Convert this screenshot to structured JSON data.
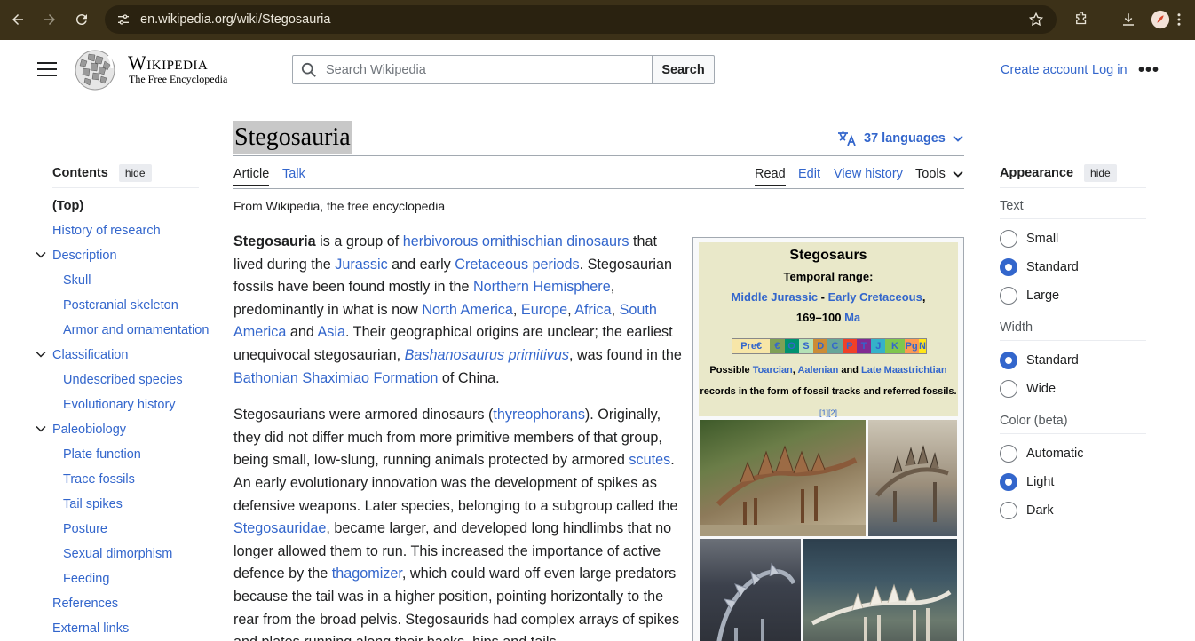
{
  "browser": {
    "url": "en.wikipedia.org/wiki/Stegosauria"
  },
  "header": {
    "wordmark": "Wikipedia",
    "tagline": "The Free Encyclopedia",
    "search_placeholder": "Search Wikipedia",
    "search_button": "Search",
    "create_account": "Create account",
    "log_in": "Log in"
  },
  "toc": {
    "title": "Contents",
    "hide": "hide",
    "items": [
      {
        "label": "(Top)"
      },
      {
        "label": "History of research"
      },
      {
        "label": "Description"
      },
      {
        "label": "Skull"
      },
      {
        "label": "Postcranial skeleton"
      },
      {
        "label": "Armor and ornamentation"
      },
      {
        "label": "Classification"
      },
      {
        "label": "Undescribed species"
      },
      {
        "label": "Evolutionary history"
      },
      {
        "label": "Paleobiology"
      },
      {
        "label": "Plate function"
      },
      {
        "label": "Trace fossils"
      },
      {
        "label": "Tail spikes"
      },
      {
        "label": "Posture"
      },
      {
        "label": "Sexual dimorphism"
      },
      {
        "label": "Feeding"
      },
      {
        "label": "References"
      },
      {
        "label": "External links"
      }
    ]
  },
  "page": {
    "title": "Stegosauria",
    "languages": "37 languages",
    "tabs": {
      "article": "Article",
      "talk": "Talk",
      "read": "Read",
      "edit": "Edit",
      "history": "View history",
      "tools": "Tools"
    },
    "from": "From Wikipedia, the free encyclopedia"
  },
  "body": {
    "p1": {
      "a": "Stegosauria",
      "b": " is a group of ",
      "c": "herbivorous",
      "d": " ",
      "e": "ornithischian",
      "f": " ",
      "g": "dinosaurs",
      "h": " that lived during the ",
      "i": "Jurassic",
      "j": " and early ",
      "k": "Cretaceous periods",
      "l": ". Stegosaurian fossils have been found mostly in the ",
      "m": "Northern Hemisphere",
      "n": ", predominantly in what is now ",
      "o": "North America",
      "p": ", ",
      "q": "Europe",
      "r": ", ",
      "s": "Africa",
      "t": ", ",
      "u": "South America",
      "v": " and ",
      "w": "Asia",
      "x": ". Their geographical origins are unclear; the earliest unequivocal stegosaurian, ",
      "y": "Bashanosaurus primitivus",
      "z": ", was found in the ",
      "aa": "Bathonian",
      "ab": " ",
      "ac": "Shaximiao Formation",
      "ad": " of China."
    },
    "p2": {
      "a": "Stegosaurians were armored dinosaurs (",
      "b": "thyreophorans",
      "c": "). Originally, they did not differ much from more primitive members of that group, being small, low-slung, running animals protected by armored ",
      "d": "scutes",
      "e": ". An early evolutionary innovation was the development of spikes as defensive weapons. Later species, belonging to a subgroup called the ",
      "f": "Stegosauridae",
      "g": ", became larger, and developed long hindlimbs that no longer allowed them to run. This increased the importance of active defence by the ",
      "h": "thagomizer",
      "i": ", which could ward off even large predators because the tail was in a higher position, pointing horizontally to the rear from the broad pelvis. Stegosaurids had complex arrays of spikes and plates running along their backs, hips and tails."
    }
  },
  "infobox": {
    "title": "Stegosaurs",
    "range_label": "Temporal range:",
    "range_start": "Middle Jurassic",
    "range_sep": " - ",
    "range_end": "Early Cretaceous",
    "range_comma": ",",
    "ma_value": "169–100 ",
    "ma_unit": "Ma",
    "timeline": [
      "Pre€",
      "€",
      "O",
      "S",
      "D",
      "C",
      "P",
      "T",
      "J",
      "K",
      "Pg",
      "N"
    ],
    "note_a": "Possible ",
    "note_b": "Toarcian",
    "note_c": ", ",
    "note_d": "Aalenian",
    "note_e": " and ",
    "note_f": "Late Maastrichtian",
    "note_g": " records in the form of fossil tracks and referred fossils.",
    "note_refs": "[1][2]"
  },
  "appearance": {
    "title": "Appearance",
    "hide": "hide",
    "text_label": "Text",
    "text_options": [
      "Small",
      "Standard",
      "Large"
    ],
    "width_label": "Width",
    "width_options": [
      "Standard",
      "Wide"
    ],
    "color_label": "Color (beta)",
    "color_options": [
      "Automatic",
      "Light",
      "Dark"
    ]
  },
  "colors": {
    "link": "#3366cc",
    "chrome_bg": "#3c3118",
    "infobox_head": "#e9e8c9"
  }
}
